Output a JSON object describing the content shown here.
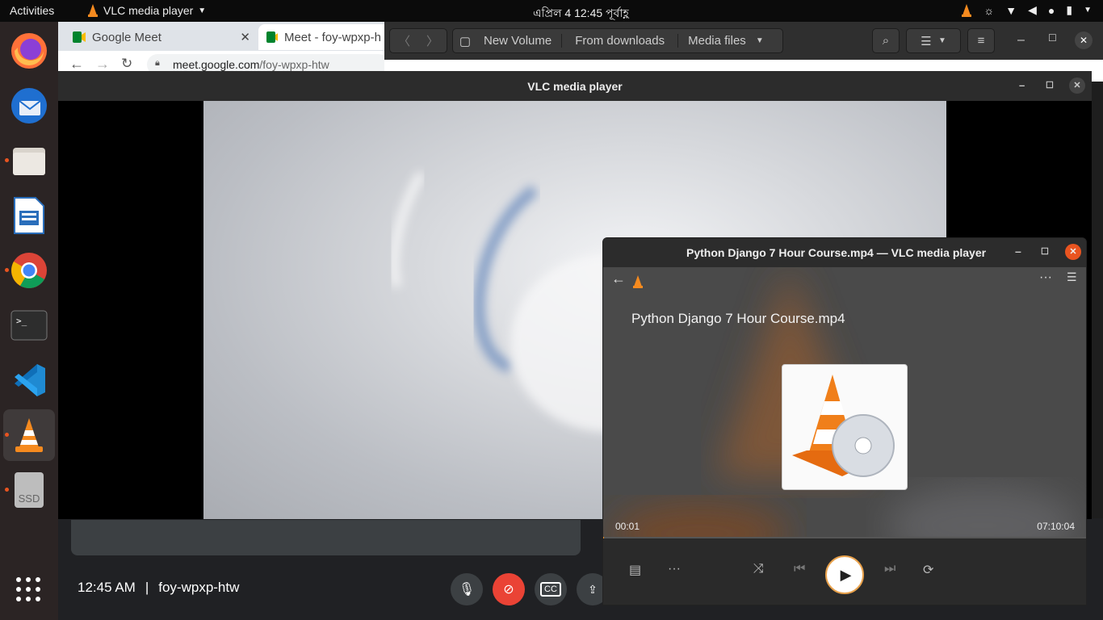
{
  "topbar": {
    "activities": "Activities",
    "app_name": "VLC media player",
    "clock": "এপ্রিল 4  12:45 পূর্বাহ্ণ"
  },
  "dock": {
    "items": [
      {
        "name": "firefox-icon",
        "running": false
      },
      {
        "name": "thunderbird-icon",
        "running": false
      },
      {
        "name": "files-icon",
        "running": true
      },
      {
        "name": "libreoffice-writer-icon",
        "running": false
      },
      {
        "name": "chrome-icon",
        "running": true
      },
      {
        "name": "terminal-icon",
        "running": false
      },
      {
        "name": "vscode-icon",
        "running": false
      },
      {
        "name": "vlc-icon",
        "running": true
      },
      {
        "name": "ssd-drive-icon",
        "running": true
      }
    ],
    "ssd_label": "SSD"
  },
  "browser": {
    "tabs": [
      {
        "label": "Google Meet"
      },
      {
        "label": "Meet - foy-wpxp-h"
      }
    ],
    "url_host": "meet.google.com",
    "url_path": "/foy-wpxp-htw"
  },
  "files": {
    "breadcrumbs": [
      "New Volume",
      "From downloads",
      "Media files"
    ]
  },
  "meet": {
    "time": "12:45 AM",
    "separator": "|",
    "meeting_code": "foy-wpxp-htw"
  },
  "vlc_main": {
    "title": "VLC media player"
  },
  "vlc_mini": {
    "title": "Python Django 7 Hour Course.mp4 — VLC media player",
    "media_title": "Python Django 7 Hour Course.mp4",
    "elapsed": "00:01",
    "duration": "07:10:04",
    "progress": 4e-05
  },
  "colors": {
    "accent": "#e95420",
    "vlc_orange": "#f58a1f",
    "meet_red": "#ea4335"
  }
}
